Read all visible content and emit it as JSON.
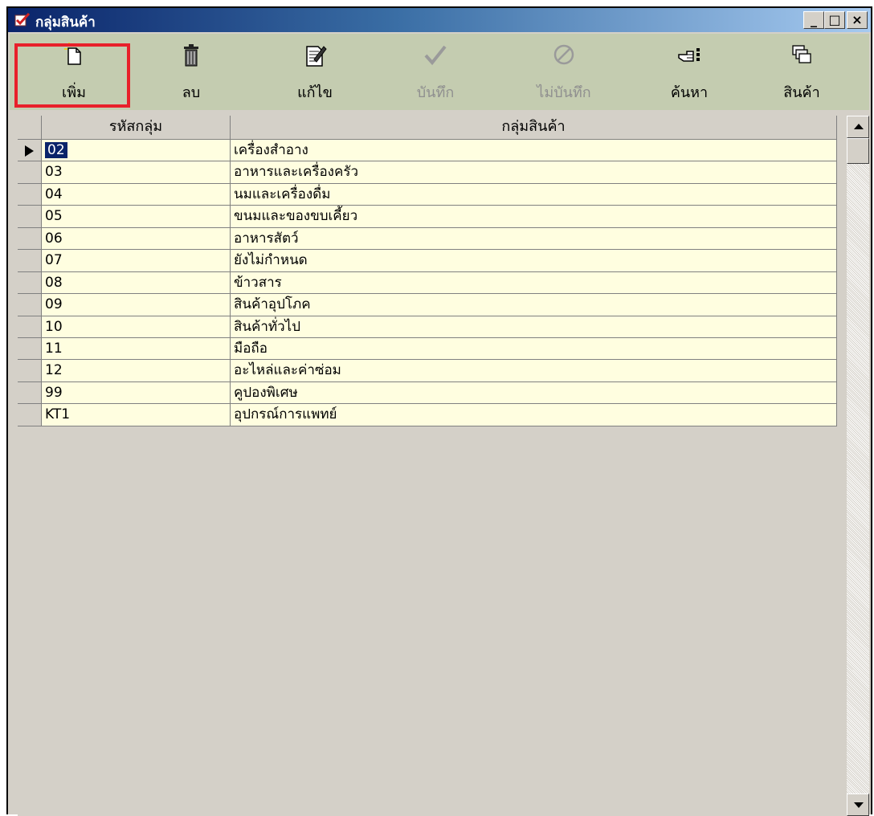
{
  "window": {
    "title": "กลุ่มสินค้า",
    "minimize_label": "_",
    "maximize_label": "□",
    "close_label": "×"
  },
  "toolbar": {
    "add_label": "เพิ่ม",
    "delete_label": "ลบ",
    "edit_label": "แก้ไข",
    "save_label": "บันทึก",
    "cancel_label": "ไม่บันทึก",
    "search_label": "ค้นหา",
    "products_label": "สินค้า"
  },
  "grid": {
    "columns": [
      "รหัสกลุ่ม",
      "กลุ่มสินค้า"
    ],
    "rows": [
      {
        "code": "02",
        "name": "เครื่องสำอาง"
      },
      {
        "code": "03",
        "name": "อาหารและเครื่องครัว"
      },
      {
        "code": "04",
        "name": "นมและเครื่องดื่ม"
      },
      {
        "code": "05",
        "name": "ขนมและของขบเคี้ยว"
      },
      {
        "code": "06",
        "name": "อาหารสัตว์"
      },
      {
        "code": "07",
        "name": "ยังไม่กำหนด"
      },
      {
        "code": "08",
        "name": "ข้าวสาร"
      },
      {
        "code": "09",
        "name": "สินค้าอุปโภค"
      },
      {
        "code": "10",
        "name": "สินค้าทั่วไป"
      },
      {
        "code": "11",
        "name": "มือถือ"
      },
      {
        "code": "12",
        "name": "อะไหล่และค่าซ่อม"
      },
      {
        "code": "99",
        "name": "คูปองพิเศษ"
      },
      {
        "code": "KT1",
        "name": "อุปกรณ์การแพทย์"
      }
    ]
  },
  "colors": {
    "title_gradient_start": "#0a246a",
    "toolbar_bg": "#c4ccb0",
    "cell_bg": "#fffee0",
    "selection_bg": "#0a246a",
    "highlight_box": "#e8202a"
  },
  "icons": {
    "add": "new-document-icon",
    "delete": "trash-icon",
    "edit": "edit-document-icon",
    "save": "checkmark-icon",
    "cancel": "prohibited-icon",
    "search": "pointing-hand-icon",
    "products": "stacked-boxes-icon"
  }
}
